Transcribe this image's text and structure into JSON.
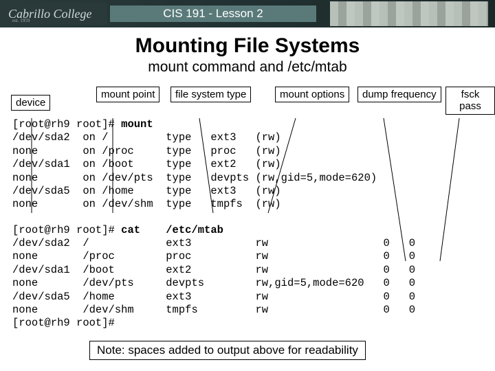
{
  "header": {
    "logo_text": "Cabrillo College",
    "est": "est. 1959",
    "course_title": "CIS 191 - Lesson 2"
  },
  "titles": {
    "main": "Mounting File Systems",
    "sub": "mount command and /etc/mtab"
  },
  "labels": {
    "device": "device",
    "mountpoint": "mount\npoint",
    "fstype": "file system\ntype",
    "options": "mount\noptions",
    "dump": "dump\nfrequency",
    "fsck": "fsck\npass"
  },
  "block1": "[root@rh9 root]# <b>mount</b>\n/dev/sda2  on /         type   ext3   (rw)\nnone       on /proc     type   proc   (rw)\n/dev/sda1  on /boot     type   ext2   (rw)\nnone       on /dev/pts  type   devpts (rw,gid=5,mode=620)\n/dev/sda5  on /home     type   ext3   (rw)\nnone       on /dev/shm  type   tmpfs  (rw)",
  "block2": "[root@rh9 root]# <b>cat    /etc/mtab</b>\n/dev/sda2  /            ext3          rw                  0   0\nnone       /proc        proc          rw                  0   0\n/dev/sda1  /boot        ext2          rw                  0   0\nnone       /dev/pts     devpts        rw,gid=5,mode=620   0   0\n/dev/sda5  /home        ext3          rw                  0   0\nnone       /dev/shm     tmpfs         rw                  0   0\n[root@rh9 root]#",
  "footnote": "Note: spaces added to output above for readability"
}
